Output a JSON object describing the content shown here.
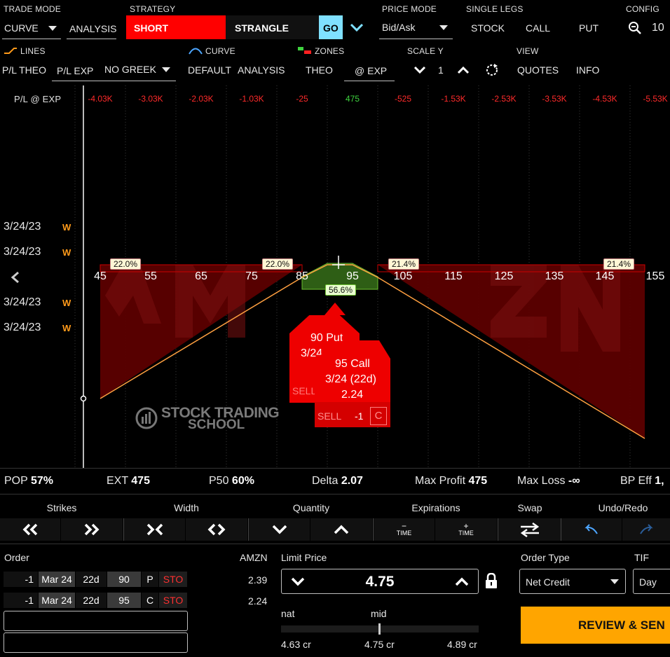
{
  "header": {
    "trade_mode_label": "TRADE MODE",
    "trade_mode_value": "CURVE",
    "analysis_tab": "ANALYSIS",
    "strategy_label": "STRATEGY",
    "strategy_side": "SHORT",
    "strategy_type": "STRANGLE",
    "go_button": "GO",
    "price_mode_label": "PRICE MODE",
    "price_mode_value": "Bid/Ask",
    "single_legs_label": "SINGLE LEGS",
    "stock_btn": "STOCK",
    "call_btn": "CALL",
    "put_btn": "PUT",
    "config_label": "CONFIG",
    "config_value": "10"
  },
  "row2": {
    "lines_label": "LINES",
    "pl_theo": "P/L THEO",
    "pl_exp": "P/L EXP",
    "no_greek": "NO GREEK",
    "curve_label": "CURVE",
    "default": "DEFAULT",
    "analysis": "ANALYSIS",
    "zones_label": "ZONES",
    "theo": "THEO",
    "at_exp": "@ EXP",
    "scale_y_label": "SCALE Y",
    "scale_y_value": "1",
    "view_label": "VIEW",
    "quotes": "QUOTES",
    "info": "INFO"
  },
  "pl_row": {
    "label": "P/L @ EXP",
    "values": [
      "-4.03K",
      "-3.03K",
      "-2.03K",
      "-1.03K",
      "-25",
      "475",
      "-525",
      "-1.53K",
      "-2.53K",
      "-3.53K",
      "-4.53K",
      "-5.53K"
    ]
  },
  "dates": {
    "d1": "3/24/23",
    "d2": "3/24/23",
    "d3": "3/24/23",
    "d4": "3/24/23",
    "w": "W"
  },
  "strikes": [
    "45",
    "55",
    "65",
    "75",
    "85",
    "95",
    "105",
    "115",
    "125",
    "135",
    "145",
    "155"
  ],
  "probabilities": {
    "p1": "22.0%",
    "p2": "22.0%",
    "p3": "21.4%",
    "p4": "21.4%",
    "center": "56.6%"
  },
  "put_card": {
    "title": "90 Put",
    "date": "3/24",
    "action": "SELL"
  },
  "call_card": {
    "title": "95 Call",
    "date": "3/24 (22d)",
    "price": "2.24",
    "action": "SELL",
    "qty": "-1",
    "type": "C"
  },
  "watermark": {
    "line1": "STOCK TRADING",
    "line2": "SCHOOL"
  },
  "stats": {
    "pop_label": "POP",
    "pop": "57%",
    "ext_label": "EXT",
    "ext": "475",
    "p50_label": "P50",
    "p50": "60%",
    "delta_label": "Delta",
    "delta": "2.07",
    "max_profit_label": "Max Profit",
    "max_profit": "475",
    "max_loss_label": "Max Loss",
    "max_loss": "-∞",
    "bp_label": "BP Eff",
    "bp": "1,"
  },
  "toolbar": {
    "strikes": "Strikes",
    "width": "Width",
    "quantity": "Quantity",
    "expirations": "Expirations",
    "swap": "Swap",
    "undo_redo": "Undo/Redo",
    "time": "TIME"
  },
  "order": {
    "title": "Order",
    "symbol": "AMZN",
    "legs": [
      {
        "qty": "-1",
        "exp": "Mar 24",
        "dte": "22d",
        "strike": "90",
        "type": "P",
        "action": "STO",
        "price": "2.39"
      },
      {
        "qty": "-1",
        "exp": "Mar 24",
        "dte": "22d",
        "strike": "95",
        "type": "C",
        "action": "STO",
        "price": "2.24"
      }
    ]
  },
  "limit": {
    "label": "Limit Price",
    "value": "4.75",
    "nat_label": "nat",
    "mid_label": "mid",
    "low": "4.63 cr",
    "mid": "4.75 cr",
    "high": "4.89 cr"
  },
  "order_type": {
    "label": "Order Type",
    "value": "Net Credit",
    "tif_label": "TIF",
    "tif_value": "Day",
    "review_btn": "REVIEW & SEN"
  },
  "colors": {
    "accent_red": "#ff0000",
    "go_cyan": "#7fe0ff",
    "review_orange": "#ffa500",
    "profit_green": "#3fd33f"
  }
}
